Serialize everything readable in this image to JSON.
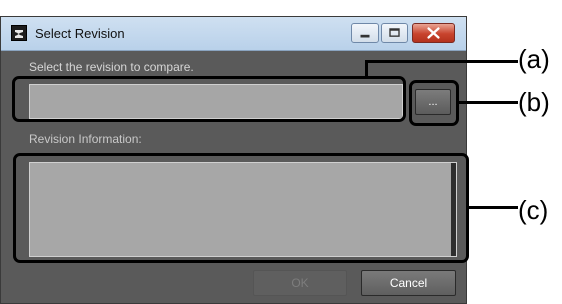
{
  "window": {
    "title": "Select Revision",
    "app_icon": "app-icon",
    "controls": [
      "minimize-icon",
      "maximize-icon",
      "close-icon"
    ],
    "close_color": "#c8432d"
  },
  "dialog": {
    "prompt": "Select the revision to compare.",
    "revision_field": {
      "value": "",
      "placeholder": ""
    },
    "browse_label": "...",
    "info_label": "Revision Information:",
    "ok_label": "OK",
    "cancel_label": "Cancel"
  },
  "annotations": {
    "a": "(a)",
    "b": "(b)",
    "c": "(c)"
  }
}
